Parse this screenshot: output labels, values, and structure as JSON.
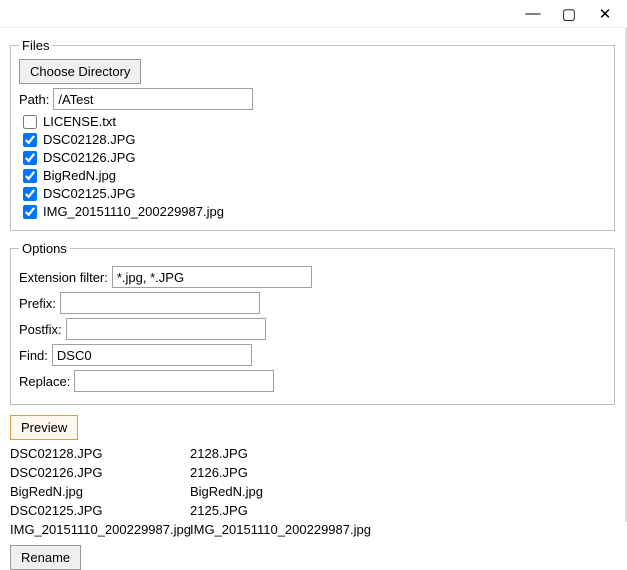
{
  "titlebar": {
    "minimize": "—",
    "maximize": "▢",
    "close": "✕"
  },
  "files_group": {
    "legend": "Files",
    "choose_dir_label": "Choose Directory",
    "path_label": "Path:",
    "path_value": "/ATest",
    "items": [
      {
        "name": "LICENSE.txt",
        "checked": false
      },
      {
        "name": "DSC02128.JPG",
        "checked": true
      },
      {
        "name": "DSC02126.JPG",
        "checked": true
      },
      {
        "name": "BigRedN.jpg",
        "checked": true
      },
      {
        "name": "DSC02125.JPG",
        "checked": true
      },
      {
        "name": "IMG_20151110_200229987.jpg",
        "checked": true
      }
    ]
  },
  "options_group": {
    "legend": "Options",
    "ext_label": "Extension filter:",
    "ext_value": "*.jpg, *.JPG",
    "prefix_label": "Prefix:",
    "prefix_value": "",
    "postfix_label": "Postfix:",
    "postfix_value": "",
    "find_label": "Find:",
    "find_value": "DSC0",
    "replace_label": "Replace:",
    "replace_value": ""
  },
  "buttons": {
    "preview": "Preview",
    "rename": "Rename"
  },
  "preview": [
    {
      "from": "DSC02128.JPG",
      "to": "2128.JPG"
    },
    {
      "from": "DSC02126.JPG",
      "to": "2126.JPG"
    },
    {
      "from": "BigRedN.jpg",
      "to": "BigRedN.jpg"
    },
    {
      "from": "DSC02125.JPG",
      "to": "2125.JPG"
    },
    {
      "from": "IMG_20151110_200229987.jpg",
      "to": "IMG_20151110_200229987.jpg"
    }
  ]
}
